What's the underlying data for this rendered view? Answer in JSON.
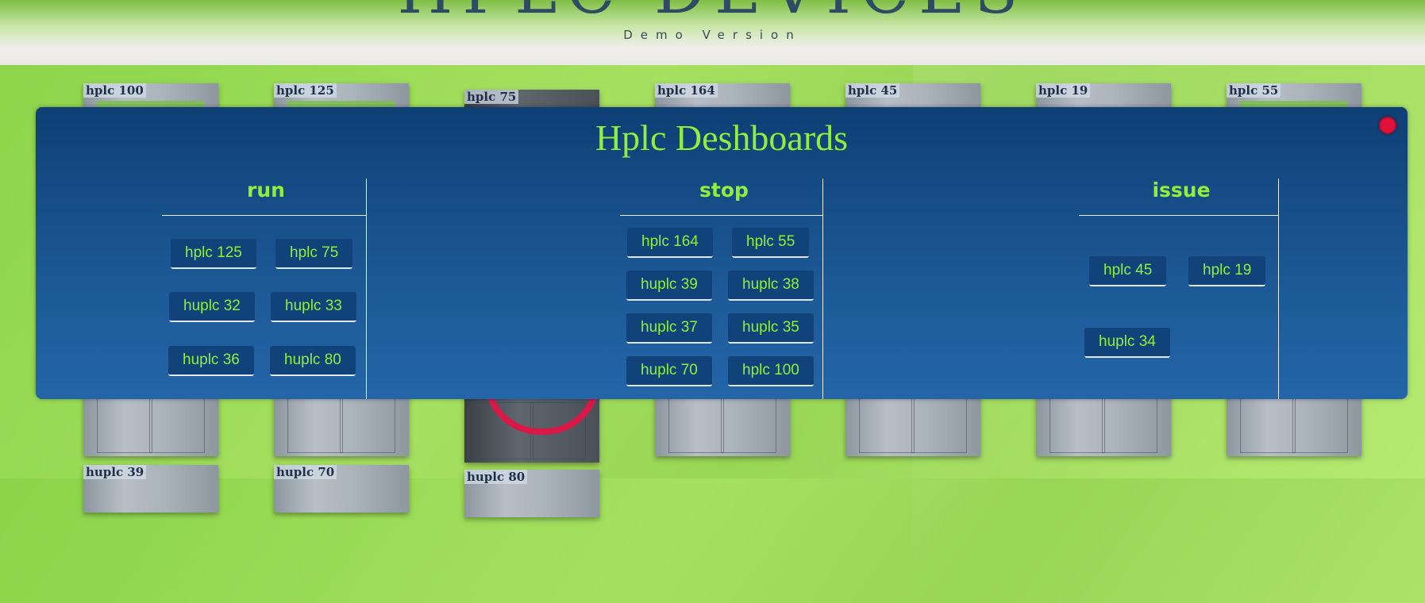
{
  "header": {
    "title": "HPLC DEVICES",
    "subtitle": "Demo Version"
  },
  "devices": [
    {
      "label": "hplc 100"
    },
    {
      "label": "hplc 125"
    },
    {
      "label": "hplc 75"
    },
    {
      "label": "hplc 164"
    },
    {
      "label": "hplc 45"
    },
    {
      "label": "hplc 19"
    },
    {
      "label": "hplc 55"
    },
    {
      "label": "huplc 39"
    },
    {
      "label": "huplc 70"
    },
    {
      "label": "huplc 80"
    }
  ],
  "modal": {
    "title": "Hplc Deshboards",
    "columns": [
      {
        "heading": "run",
        "items": [
          "hplc 125",
          "hplc 75",
          "huplc 32",
          "huplc 33",
          "huplc 36",
          "huplc 80"
        ]
      },
      {
        "heading": "stop",
        "items": [
          "hplc 164",
          "hplc 55",
          "huplc 39",
          "huplc 38",
          "huplc 37",
          "huplc 35",
          "huplc 70",
          "hplc 100"
        ]
      },
      {
        "heading": "issue",
        "items": [
          "hplc 45",
          "hplc 19",
          "huplc 34"
        ]
      }
    ]
  },
  "colors": {
    "accent_green": "#8ff03c",
    "modal_blue": "#11427a",
    "close_red": "#e0123a",
    "background_green": "#a6e060"
  },
  "icons": {
    "close": "close-icon"
  }
}
